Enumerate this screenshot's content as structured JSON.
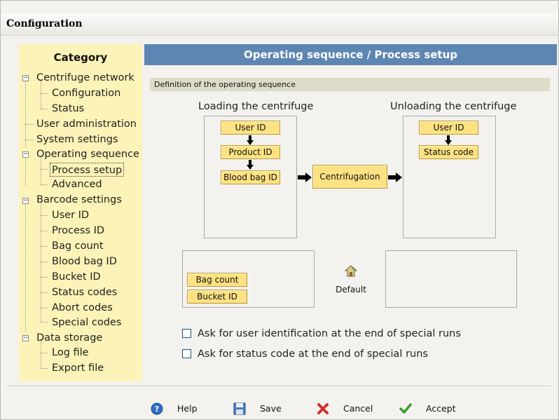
{
  "window": {
    "title": "Configuration"
  },
  "sidebar": {
    "heading": "Category",
    "items": [
      {
        "label": "Centrifuge network",
        "level": 0,
        "expander": "−"
      },
      {
        "label": "Configuration",
        "level": 1
      },
      {
        "label": "Status",
        "level": 1
      },
      {
        "label": "User administration",
        "level": 0
      },
      {
        "label": "System settings",
        "level": 0
      },
      {
        "label": "Operating sequence",
        "level": 0,
        "expander": "−"
      },
      {
        "label": "Process setup",
        "level": 1,
        "selected": true
      },
      {
        "label": "Advanced",
        "level": 1
      },
      {
        "label": "Barcode settings",
        "level": 0,
        "expander": "−"
      },
      {
        "label": "User ID",
        "level": 1
      },
      {
        "label": "Process ID",
        "level": 1
      },
      {
        "label": "Bag count",
        "level": 1
      },
      {
        "label": "Blood bag ID",
        "level": 1
      },
      {
        "label": "Bucket ID",
        "level": 1
      },
      {
        "label": "Status codes",
        "level": 1
      },
      {
        "label": "Abort codes",
        "level": 1
      },
      {
        "label": "Special codes",
        "level": 1
      },
      {
        "label": "Data storage",
        "level": 0,
        "expander": "−"
      },
      {
        "label": "Log file",
        "level": 1
      },
      {
        "label": "Export file",
        "level": 1
      }
    ]
  },
  "main": {
    "header": "Operating sequence / Process setup",
    "definition_label": "Definition of the operating sequence",
    "loading": {
      "label": "Loading the centrifuge",
      "steps": [
        "User ID",
        "Product ID",
        "Blood bag ID"
      ]
    },
    "centrifugation": "Centrifugation",
    "unloading": {
      "label": "Unloading the centrifuge",
      "steps": [
        "User ID",
        "Status code"
      ]
    },
    "available": [
      "Bag count",
      "Bucket ID"
    ],
    "default_label": "Default",
    "checkboxes": [
      {
        "label": "Ask for user identification at the end of special runs",
        "checked": false
      },
      {
        "label": "Ask for status code at the end of special runs",
        "checked": false
      }
    ]
  },
  "footer": {
    "help": "Help",
    "save": "Save",
    "cancel": "Cancel",
    "accept": "Accept"
  },
  "colors": {
    "header_blue": "#5d86b3",
    "sidebar_yellow": "#fbf3b7",
    "button_yellow": "#fde283"
  }
}
